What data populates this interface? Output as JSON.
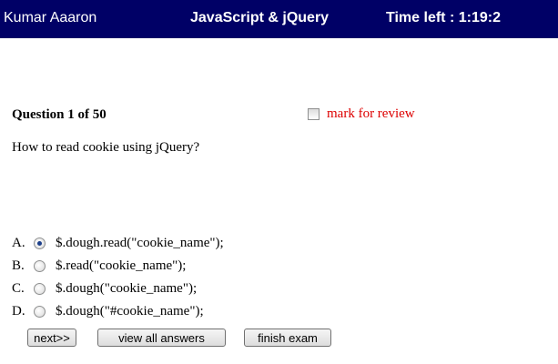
{
  "header": {
    "user_name": "Kumar Aaaron",
    "exam_title": "JavaScript & jQuery",
    "time_left": "Time left : 1:19:2",
    "background_color": "#000066"
  },
  "question": {
    "number_label": "Question 1 of 50",
    "mark_for_review_label": "mark for review",
    "mark_for_review_checked": false,
    "text": "How to read cookie using jQuery?",
    "options": [
      {
        "letter": "A.",
        "text": "$.dough.read(\"cookie_name\");",
        "selected": true
      },
      {
        "letter": "B.",
        "text": "$.read(\"cookie_name\");",
        "selected": false
      },
      {
        "letter": "C.",
        "text": "$.dough(\"cookie_name\");",
        "selected": false
      },
      {
        "letter": "D.",
        "text": "$.dough(\"#cookie_name\");",
        "selected": false
      }
    ]
  },
  "buttons": {
    "next_label": "next>>",
    "view_all_label": "view all answers",
    "finish_label": "finish exam"
  },
  "colors": {
    "review_text": "#dd0000"
  }
}
